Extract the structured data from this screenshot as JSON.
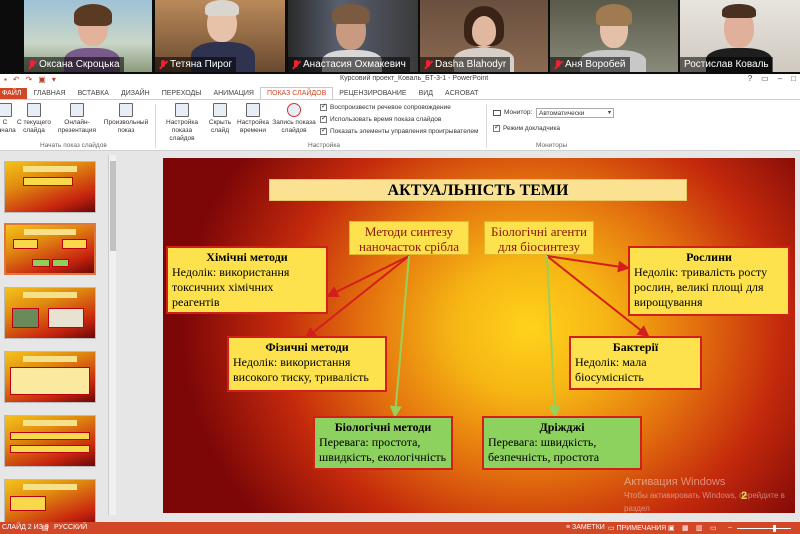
{
  "participants": [
    {
      "name": "Оксана Скроцька"
    },
    {
      "name": "Тетяна Пирог"
    },
    {
      "name": "Анастасия Охмакевич"
    },
    {
      "name": "Dasha Blahodyr"
    },
    {
      "name": "Аня Воробей"
    },
    {
      "name": "Ростислав Коваль"
    }
  ],
  "window": {
    "title": "Курсовий проект_Коваль_БТ-3-1 - PowerPoint",
    "help": "?"
  },
  "tabs": [
    "ФАЙЛ",
    "ГЛАВНАЯ",
    "ВСТАВКА",
    "ДИЗАЙН",
    "ПЕРЕХОДЫ",
    "АНИМАЦИЯ",
    "ПОКАЗ СЛАЙДОВ",
    "РЕЦЕНЗИРОВАНИЕ",
    "ВИД",
    "ACROBAT"
  ],
  "active_tab": "ПОКАЗ СЛАЙДОВ",
  "ribbon": {
    "start": {
      "from_start": "С начала",
      "from_current": "С текущего слайда",
      "online": "Онлайн-презентация",
      "custom": "Произвольный показ",
      "group": "Начать показ слайдов"
    },
    "setup": {
      "setup_show": "Настройка показа слайдов",
      "hide": "Скрыть слайд",
      "rehearse": "Настройка времени",
      "record": "Запись показа слайдов",
      "group": "Настройка"
    },
    "checks": [
      {
        "label": "Воспроизвести речевое сопровождение",
        "checked": true
      },
      {
        "label": "Использовать время показа слайдов",
        "checked": true
      },
      {
        "label": "Показать элементы управления проигрывателем",
        "checked": true
      }
    ],
    "monitors": {
      "monitor_label": "Монитор:",
      "monitor_value": "Автоматически",
      "presenter": "Режим докладчика",
      "group": "Мониторы"
    }
  },
  "slide": {
    "title": "АКТУАЛЬНІСТЬ ТЕМИ",
    "synthesis": "Методи синтезу наночасток срібла",
    "agents": "Біологічні агенти для біосинтезу",
    "chemical": {
      "head": "Хімічні методи",
      "text": "Недолік: використання токсичних хімічних реагентів"
    },
    "physical": {
      "head": "Фізичні методи",
      "text": "Недолік: використання високого тиску, тривалість"
    },
    "biological": {
      "head": "Біологічні методи",
      "text": "Перевага: простота, швидкість, екологічність"
    },
    "plants": {
      "head": "Рослини",
      "text": "Недолік: тривалість росту рослин, великі площі для вирощування"
    },
    "bacteria": {
      "head": "Бактерії",
      "text": "Недолік: мала біосумісність"
    },
    "yeast": {
      "head": "Дріжджі",
      "text": "Перевага: швидкість, безпечність, простота"
    },
    "page": "2"
  },
  "watermark": {
    "line1": "Активация Windows",
    "line2": "Чтобы активировать Windows, перейдите в раздел"
  },
  "status": {
    "slide": "СЛАЙД 2 ИЗ 9",
    "lang": "РУССКИЙ",
    "notes": "ЗАМЕТКИ",
    "comments": "ПРИМЕЧАНИЯ"
  },
  "colors": {
    "accent": "#d24726",
    "box_yellow": "#fde24d",
    "box_green": "#8dd15e",
    "border_red": "#d31e1e"
  }
}
